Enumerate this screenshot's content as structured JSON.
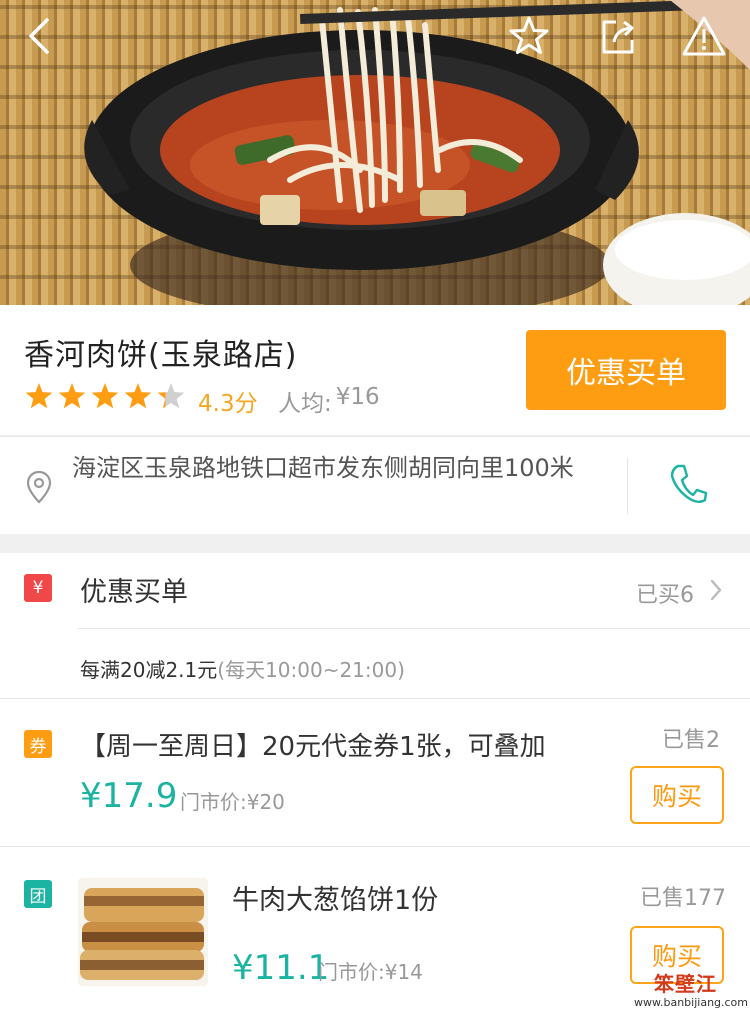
{
  "header": {
    "icons": [
      "back-icon",
      "star-icon",
      "share-icon",
      "warning-icon"
    ]
  },
  "shop": {
    "name": "香河肉饼(玉泉路店)",
    "rating": 4.3,
    "rating_label": "4.3分",
    "avg_label": "人均:",
    "avg_value": "¥16",
    "buy_button": "优惠买单",
    "address": "海淀区玉泉路地铁口超市发东侧胡同向里100米"
  },
  "colors": {
    "accent_orange": "#ff9d12",
    "price_teal": "#1bb3a1",
    "tag_red": "#f04848",
    "tag_orange": "#ff9d12",
    "tag_teal": "#1bb3a1"
  },
  "deals": {
    "discount": {
      "tag": "¥",
      "title": "优惠买单",
      "sold": "已买6",
      "desc": "每满20减2.1元",
      "time": "(每天10:00~21:00)"
    },
    "voucher": {
      "tag": "券",
      "title": "【周一至周日】20元代金券1张，可叠加",
      "sold": "已售2",
      "price": "¥17.9",
      "market_price": "门市价:¥20",
      "button": "购买"
    },
    "group": {
      "tag": "团",
      "title": "牛肉大葱馅饼1份",
      "sold": "已售177",
      "price": "¥11.1",
      "market_price": "门市价:¥14",
      "button": "购买"
    }
  },
  "watermark": {
    "text": "笨壁江",
    "url": "www.banbijiang.com"
  }
}
